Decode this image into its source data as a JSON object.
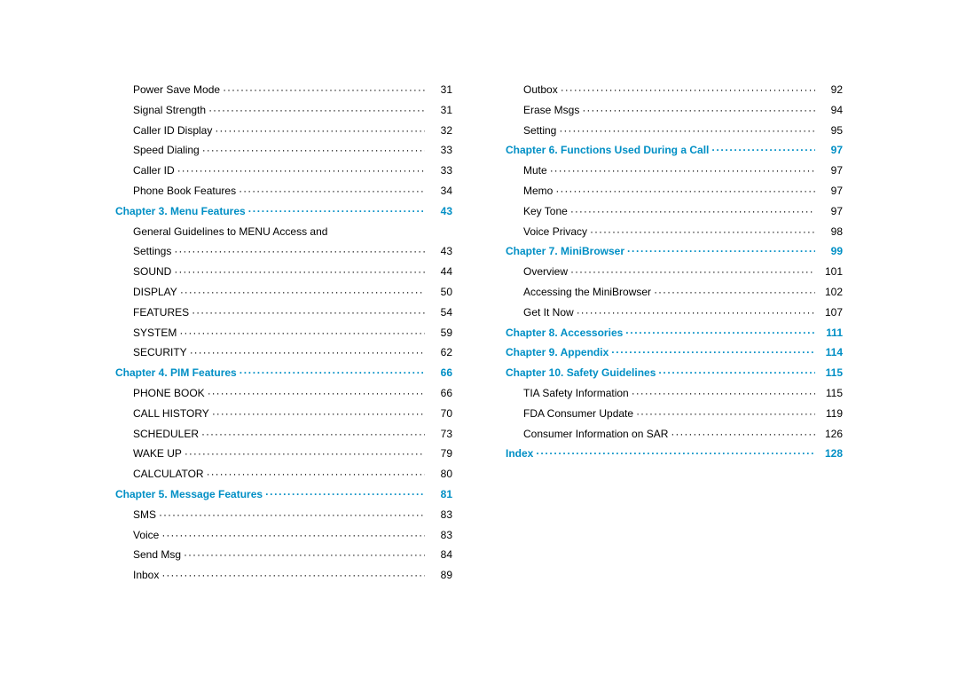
{
  "columns": [
    [
      {
        "type": "sub",
        "label": "Power Save Mode",
        "page": "31"
      },
      {
        "type": "sub",
        "label": "Signal Strength",
        "page": "31"
      },
      {
        "type": "sub",
        "label": "Caller ID Display",
        "page": "32"
      },
      {
        "type": "sub",
        "label": "Speed Dialing",
        "page": "33"
      },
      {
        "type": "sub",
        "label": "Caller ID",
        "page": "33"
      },
      {
        "type": "sub",
        "label": "Phone Book Features",
        "page": "34"
      },
      {
        "type": "heading",
        "label": "Chapter 3. Menu Features",
        "page": "43"
      },
      {
        "type": "sub",
        "label": "General Guidelines to MENU Access and",
        "page": ""
      },
      {
        "type": "sub",
        "label": "Settings",
        "page": "43"
      },
      {
        "type": "sub",
        "label": "SOUND",
        "page": "44"
      },
      {
        "type": "sub",
        "label": "DISPLAY",
        "page": "50"
      },
      {
        "type": "sub",
        "label": "FEATURES",
        "page": "54"
      },
      {
        "type": "sub",
        "label": "SYSTEM",
        "page": "59"
      },
      {
        "type": "sub",
        "label": "SECURITY",
        "page": "62"
      },
      {
        "type": "heading",
        "label": "Chapter 4. PIM Features",
        "page": "66"
      },
      {
        "type": "sub",
        "label": "PHONE BOOK",
        "page": "66"
      },
      {
        "type": "sub",
        "label": "CALL HISTORY",
        "page": "70"
      },
      {
        "type": "sub",
        "label": "SCHEDULER",
        "page": "73"
      },
      {
        "type": "sub",
        "label": "WAKE UP",
        "page": "79"
      },
      {
        "type": "sub",
        "label": "CALCULATOR",
        "page": "80"
      },
      {
        "type": "heading",
        "label": "Chapter 5. Message Features",
        "page": "81"
      },
      {
        "type": "sub",
        "label": "SMS",
        "page": "83"
      },
      {
        "type": "sub",
        "label": "Voice",
        "page": "83"
      },
      {
        "type": "sub",
        "label": "Send  Msg",
        "page": "84"
      },
      {
        "type": "sub",
        "label": "Inbox",
        "page": "89"
      }
    ],
    [
      {
        "type": "sub",
        "label": "Outbox",
        "page": "92"
      },
      {
        "type": "sub",
        "label": "Erase Msgs",
        "page": "94"
      },
      {
        "type": "sub",
        "label": "Setting",
        "page": "95"
      },
      {
        "type": "heading",
        "label": "Chapter 6. Functions Used During a Call",
        "page": "97"
      },
      {
        "type": "sub",
        "label": "Mute",
        "page": "97"
      },
      {
        "type": "sub",
        "label": "Memo",
        "page": "97"
      },
      {
        "type": "sub",
        "label": "Key Tone",
        "page": "97"
      },
      {
        "type": "sub",
        "label": "Voice Privacy",
        "page": "98"
      },
      {
        "type": "heading",
        "label": "Chapter 7. MiniBrowser",
        "page": "99"
      },
      {
        "type": "sub",
        "label": "Overview",
        "page": "101"
      },
      {
        "type": "sub",
        "label": "Accessing the MiniBrowser",
        "page": "102"
      },
      {
        "type": "sub",
        "label": "Get It Now",
        "page": "107"
      },
      {
        "type": "heading",
        "label": "Chapter 8. Accessories",
        "page": "111"
      },
      {
        "type": "heading",
        "label": "Chapter 9. Appendix",
        "page": "114"
      },
      {
        "type": "heading",
        "label": "Chapter 10. Safety Guidelines",
        "page": "115"
      },
      {
        "type": "sub",
        "label": "TIA Safety Information",
        "page": "115"
      },
      {
        "type": "sub",
        "label": "FDA Consumer Update",
        "page": "119"
      },
      {
        "type": "sub",
        "label": "Consumer Information on SAR",
        "page": "126"
      },
      {
        "type": "heading",
        "label": "Index",
        "page": "128"
      }
    ]
  ]
}
